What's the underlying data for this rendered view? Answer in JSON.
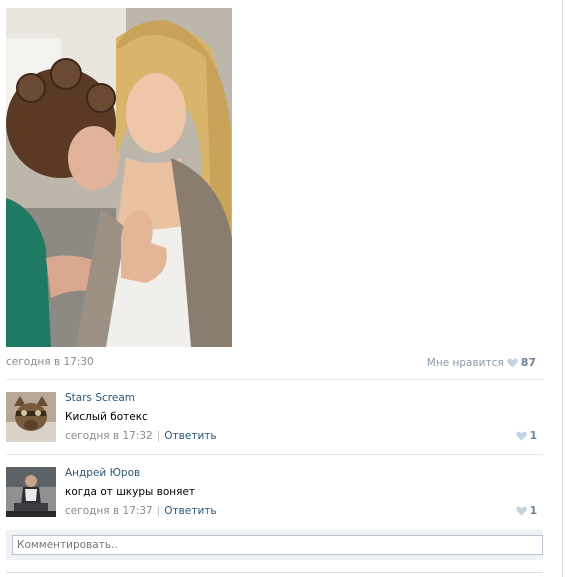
{
  "post": {
    "date": "сегодня в 17:30",
    "like_label": "Мне нравится",
    "like_count": "87"
  },
  "comments": [
    {
      "author": "Stars Scream",
      "text": "Кислый ботекс",
      "date": "сегодня в 17:32",
      "separator": "|",
      "reply_label": "Ответить",
      "like_count": "1"
    },
    {
      "author": "Андрей Юров",
      "text": "когда от шкуры воняет",
      "date": "сегодня в 17:37",
      "separator": "|",
      "reply_label": "Ответить",
      "like_count": "1"
    }
  ],
  "comment_form": {
    "placeholder": "Комментировать.."
  },
  "colors": {
    "link": "#2b587a",
    "muted": "#8a8a8a",
    "like": "#6f849c",
    "panel": "#f0f2f5"
  }
}
